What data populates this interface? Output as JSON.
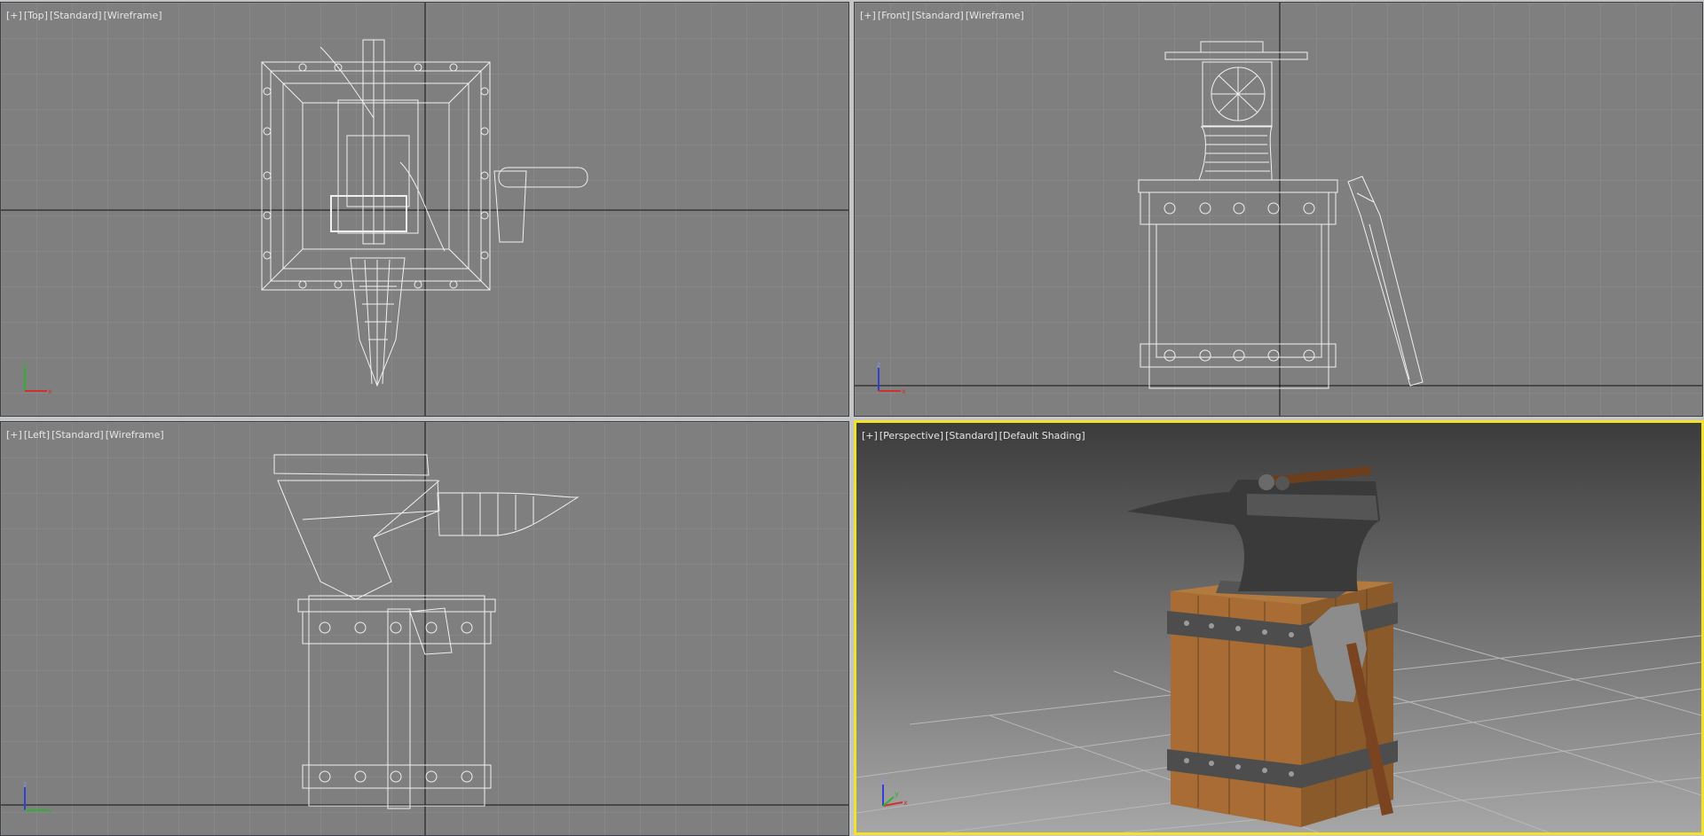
{
  "viewports": [
    {
      "id": "top",
      "menu": "[+]",
      "view": "[Top]",
      "preset": "[Standard]",
      "shading": "[Wireframe]",
      "axes": [
        "y",
        "x"
      ]
    },
    {
      "id": "front",
      "menu": "[+]",
      "view": "[Front]",
      "preset": "[Standard]",
      "shading": "[Wireframe]",
      "axes": [
        "z",
        "x"
      ]
    },
    {
      "id": "left",
      "menu": "[+]",
      "view": "[Left]",
      "preset": "[Standard]",
      "shading": "[Wireframe]",
      "axes": [
        "z",
        "y"
      ]
    },
    {
      "id": "perspective",
      "menu": "[+]",
      "view": "[Perspective]",
      "preset": "[Standard]",
      "shading": "[Default Shading]",
      "axes": [
        "z",
        "x",
        "y"
      ],
      "active": true
    }
  ],
  "colors": {
    "active_border": "#f2e22a",
    "viewport_bg": "#7f7f7f",
    "axis_x": "#d03030",
    "axis_y": "#30b030",
    "axis_z": "#3040d0"
  }
}
